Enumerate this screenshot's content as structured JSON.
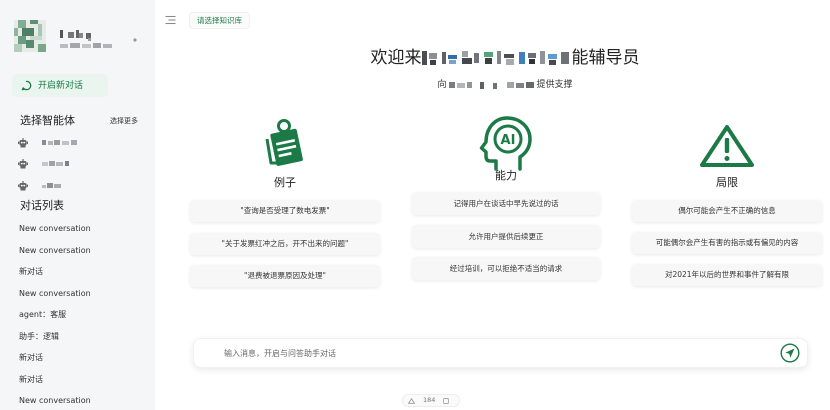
{
  "sidebar": {
    "toggle_icon": "sidebar-toggle-icon",
    "new_chat_icon": "chat-bubble-icon",
    "new_chat_label": "开启新对话",
    "agents_heading": "选择智能体",
    "agents_more_label": "选择更多",
    "agent_icon": "robot-icon",
    "conversations_heading": "对话列表",
    "conversations": [
      "New conversation",
      "New conversation",
      "新对话",
      "New conversation",
      "agent：客服",
      "助手：逻辑",
      "新对话",
      "新对话",
      "New conversation"
    ]
  },
  "header": {
    "knowledge_base_label": "请选择知识库"
  },
  "welcome": {
    "title_start": "欢迎来",
    "title_end": "能辅导员",
    "subtitle_start": "向",
    "subtitle_end": "提供支撑"
  },
  "columns": [
    {
      "icon": "clipboard-pin-icon",
      "heading": "例子",
      "items": [
        "\"查询是否受理了数电发票\"",
        "\"关于发票红冲之后，开不出来的问题\"",
        "\"退费被退票原因及处理\""
      ]
    },
    {
      "icon": "ai-head-icon",
      "icon_text": "AI",
      "heading": "能力",
      "items": [
        "记得用户在谈话中早先说过的话",
        "允许用户提供后续更正",
        "经过培训，可以拒绝不适当的请求"
      ]
    },
    {
      "icon": "warning-triangle-icon",
      "heading": "局限",
      "items": [
        "偶尔可能会产生不正确的信息",
        "可能偶尔会产生有害的指示或有偏见的内容",
        "对2021年以后的世界和事件了解有限"
      ]
    }
  ],
  "composer": {
    "placeholder": "输入消息，开启与问答助手对话",
    "send_icon": "send-icon"
  },
  "footer": {
    "counter": "184"
  },
  "colors": {
    "accent": "#1b7a45",
    "accent_bg": "#e9f5ee",
    "sidebar_bg": "#f5f6f7",
    "card_bg": "#f7f7f8"
  }
}
